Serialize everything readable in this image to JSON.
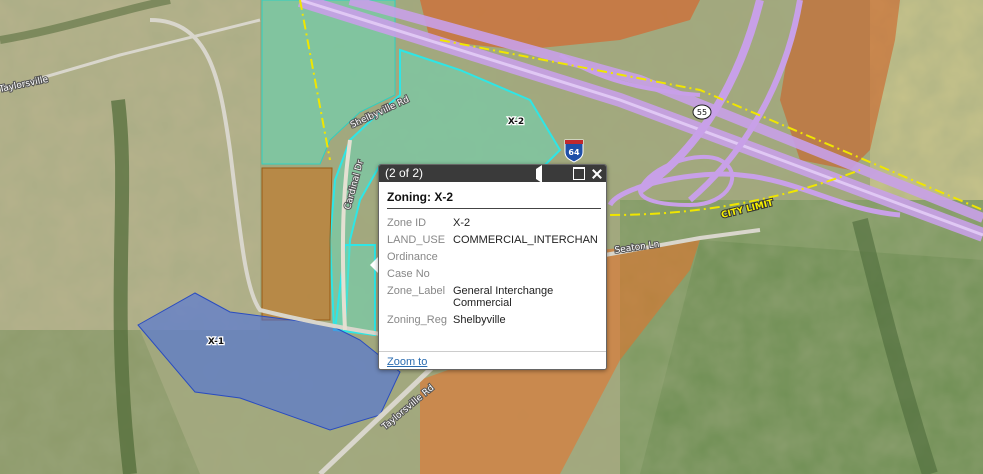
{
  "map": {
    "zone_labels": [
      "X-2",
      "X-1"
    ],
    "road_labels": [
      "Taylorsville Rd",
      "Taylorsville",
      "Shelbyville Rd",
      "Cardinal Dr",
      "Seaton Ln"
    ],
    "route_shields": {
      "interstate": "64",
      "state": "55"
    },
    "city_limit_label": "CITY LIMIT",
    "colors": {
      "zone_x2": "#5fe0c0",
      "zone_x1": "#4a6fe0",
      "zone_orange": "#f06a1e",
      "zone_brown": "#c9701a",
      "highway": "#c8a0e8",
      "city_limit": "#f0e600"
    }
  },
  "popup": {
    "counter": "(2 of 2)",
    "title": "Zoning: X-2",
    "fields": [
      {
        "name": "Zone ID",
        "value": "X-2"
      },
      {
        "name": "LAND_USE",
        "value": "COMMERCIAL_INTERCHAN"
      },
      {
        "name": "Ordinance",
        "value": ""
      },
      {
        "name": "Case No",
        "value": ""
      },
      {
        "name": "Zone_Label",
        "value": "General Interchange Commercial"
      },
      {
        "name": "Zoning_Reg",
        "value": "Shelbyville"
      }
    ],
    "zoom_link": "Zoom to"
  }
}
